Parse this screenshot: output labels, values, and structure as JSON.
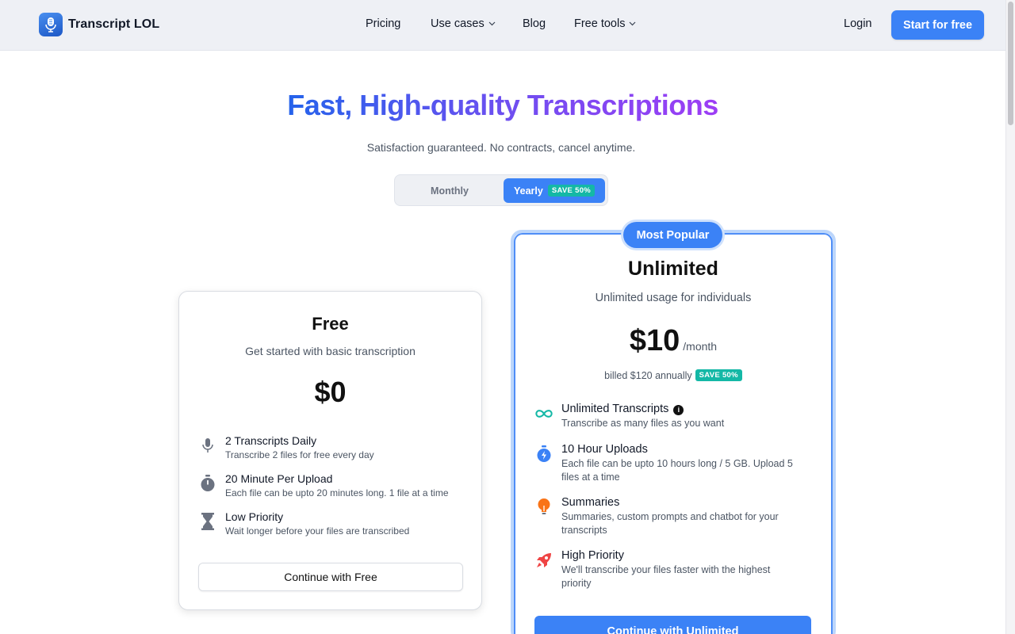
{
  "header": {
    "logo_text": "Transcript LOL",
    "nav": {
      "pricing": "Pricing",
      "use_cases": "Use cases",
      "blog": "Blog",
      "free_tools": "Free tools"
    },
    "login": "Login",
    "start": "Start for free"
  },
  "hero": {
    "title": "Fast, High-quality Transcriptions",
    "subtitle": "Satisfaction guaranteed. No contracts, cancel anytime."
  },
  "billing_toggle": {
    "monthly": "Monthly",
    "yearly": "Yearly",
    "yearly_badge": "SAVE 50%",
    "selected": "Yearly"
  },
  "plans": {
    "free": {
      "name": "Free",
      "description": "Get started with basic transcription",
      "price": "$0",
      "features": [
        {
          "title": "2 Transcripts Daily",
          "desc": "Transcribe 2 files for free every day",
          "icon": "microphone-icon"
        },
        {
          "title": "20 Minute Per Upload",
          "desc": "Each file can be upto 20 minutes long. 1 file at a time",
          "icon": "stopwatch-icon"
        },
        {
          "title": "Low Priority",
          "desc": "Wait longer before your files are transcribed",
          "icon": "hourglass-icon"
        }
      ],
      "cta": "Continue with Free"
    },
    "unlimited": {
      "badge": "Most Popular",
      "name": "Unlimited",
      "description": "Unlimited usage for individuals",
      "price": "$10",
      "period": "/month",
      "billed": "billed $120 annually",
      "billed_badge": "SAVE 50%",
      "features": [
        {
          "title": "Unlimited Transcripts",
          "desc": "Transcribe as many files as you want",
          "icon": "infinity-icon"
        },
        {
          "title": "10 Hour Uploads",
          "desc": "Each file can be upto 10 hours long / 5 GB. Upload 5 files at a time",
          "icon": "fast-stopwatch-icon"
        },
        {
          "title": "Summaries",
          "desc": "Summaries, custom prompts and chatbot for your transcripts",
          "icon": "lightbulb-icon"
        },
        {
          "title": "High Priority",
          "desc": "We'll transcribe your files faster with the highest priority",
          "icon": "rocket-icon"
        }
      ],
      "cta": "Continue with Unlimited"
    }
  },
  "colors": {
    "accent": "#3b82f6",
    "badge_green": "#10b981",
    "gradient_start": "#2563eb",
    "gradient_end": "#9d3df5"
  }
}
